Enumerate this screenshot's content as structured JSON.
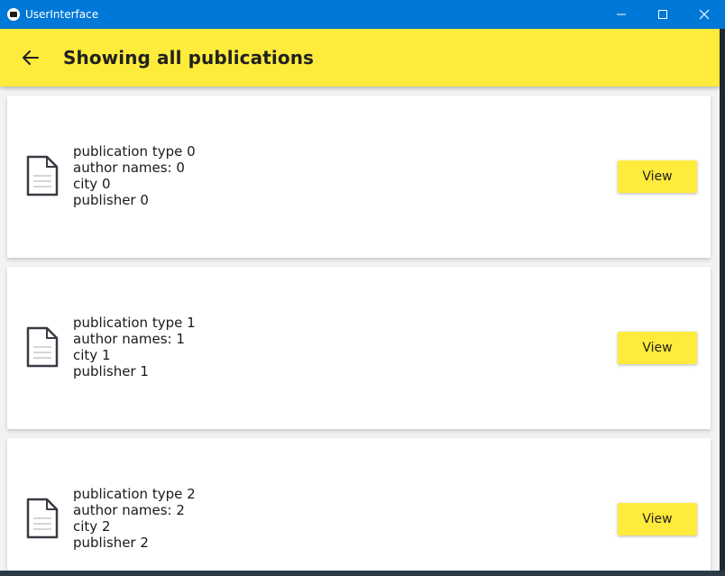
{
  "window": {
    "title": "UserInterface"
  },
  "appbar": {
    "title": "Showing all publications"
  },
  "publications": [
    {
      "type": "publication type 0",
      "authors": "author names: 0",
      "city": "city 0",
      "publisher": "publisher 0",
      "button_label": "View"
    },
    {
      "type": "publication type 1",
      "authors": "author names: 1",
      "city": "city 1",
      "publisher": "publisher 1",
      "button_label": "View"
    },
    {
      "type": "publication type 2",
      "authors": "author names: 2",
      "city": "city 2",
      "publisher": "publisher 2",
      "button_label": "View"
    }
  ],
  "icons": {
    "app": "app-icon",
    "minimize": "minimize-icon",
    "maximize": "maximize-icon",
    "close": "close-icon",
    "back": "arrow-back-icon",
    "document": "document-icon"
  },
  "colors": {
    "titlebar": "#0078d7",
    "accent": "#ffeb3b",
    "card": "#ffffff",
    "background": "#f2f2f2"
  }
}
